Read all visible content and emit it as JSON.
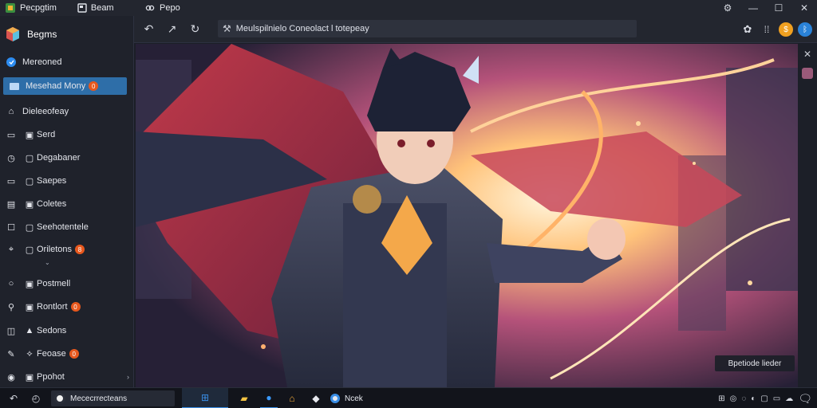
{
  "titlebar": {
    "apps": [
      {
        "label": "Pecpgtim",
        "icon": "app-logo-icon"
      },
      {
        "label": "Beam",
        "icon": "book-icon"
      }
    ],
    "tab": {
      "label": "Pepo",
      "icon": "link-icon"
    },
    "controls": [
      "settings-icon",
      "minimize-icon",
      "maximize-icon",
      "close-icon"
    ]
  },
  "sidebar": {
    "header": {
      "label": "Begms",
      "icon": "app-cube-icon"
    },
    "items": [
      {
        "label": "Mereoned",
        "icon": "shield-icon"
      },
      {
        "label": "Mesehad Mony",
        "icon": "folder-icon",
        "badge": "0",
        "active": true
      },
      {
        "label": "Dieleeofeay",
        "icon": "home-icon"
      },
      {
        "label": "Serd",
        "icon": "mail-icon"
      },
      {
        "label": "Degabaner",
        "icon": "clock-icon"
      },
      {
        "label": "Saepes",
        "icon": "image-icon"
      },
      {
        "label": "Coletes",
        "icon": "list-icon"
      },
      {
        "label": "Seehotentele",
        "icon": "box-icon"
      },
      {
        "label": "Oriletons",
        "icon": "cursor-icon",
        "badge": "8"
      },
      {
        "label": "Postmell",
        "icon": "chat-icon"
      },
      {
        "label": "Rontlort",
        "icon": "user-icon",
        "badge": "0"
      },
      {
        "label": "Sedons",
        "icon": "warning-icon"
      },
      {
        "label": "Feoase",
        "icon": "pin-icon",
        "badge": "0"
      },
      {
        "label": "Ppohot",
        "icon": "info-icon"
      }
    ]
  },
  "toolbar": {
    "address": "Meulspilnielo Coneolact l totepeay",
    "nav": [
      "back-icon",
      "up-icon",
      "refresh-icon"
    ]
  },
  "tooltip": "Bpetiode lieder",
  "taskbar": {
    "search_text": "Mececrrecteans",
    "pinned_label": "Ncek"
  },
  "colors": {
    "accent": "#2e6ea8",
    "badge": "#e8581d",
    "bg": "#1f222b"
  }
}
